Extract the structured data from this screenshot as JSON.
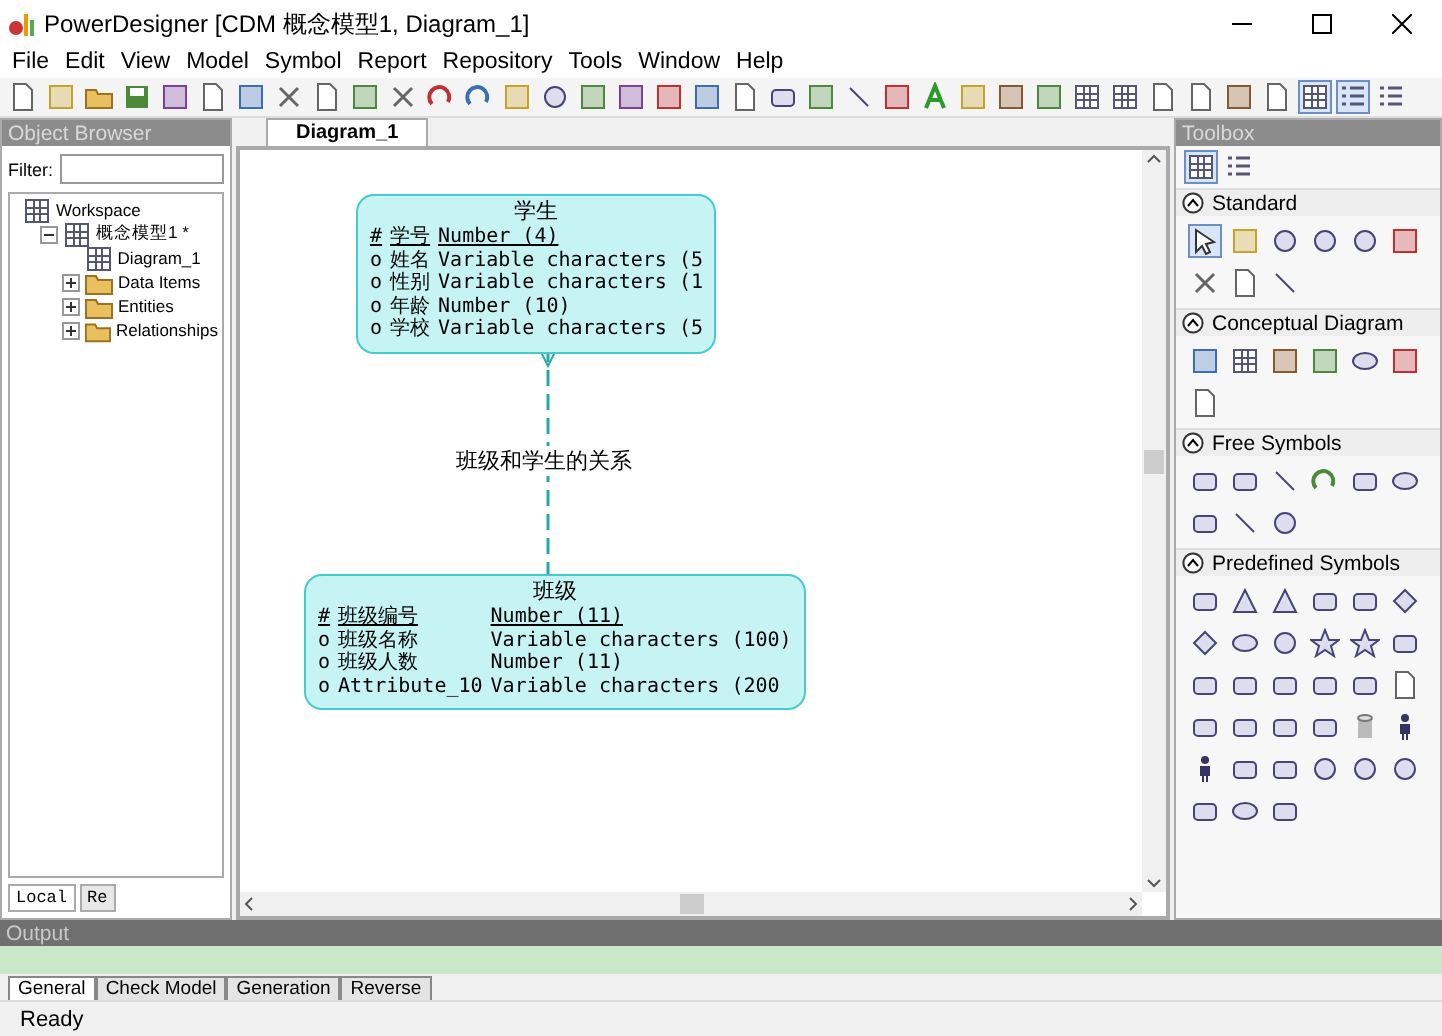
{
  "window": {
    "title": "PowerDesigner [CDM 概念模型1, Diagram_1]"
  },
  "menu": [
    "File",
    "Edit",
    "View",
    "Model",
    "Symbol",
    "Report",
    "Repository",
    "Tools",
    "Window",
    "Help"
  ],
  "object_browser": {
    "title": "Object Browser",
    "filter_label": "Filter:",
    "tree": [
      {
        "label": "Workspace",
        "children": [
          {
            "label": "概念模型1 *",
            "expanded": true,
            "children": [
              {
                "label": "Diagram_1"
              },
              {
                "label": "Data Items",
                "expanded": false
              },
              {
                "label": "Entities",
                "expanded": false
              },
              {
                "label": "Relationships",
                "expanded": false
              }
            ]
          }
        ]
      }
    ],
    "tabs": [
      {
        "label": "Local",
        "selected": true
      },
      {
        "label": "Re",
        "selected": false
      }
    ]
  },
  "document_tabs": [
    {
      "label": "Diagram_1",
      "selected": true
    }
  ],
  "diagram": {
    "entities": [
      {
        "name": "学生",
        "attributes": [
          {
            "marker": "#",
            "name": "学号",
            "type": "Number (4)",
            "identifier": true
          },
          {
            "marker": "o",
            "name": "姓名",
            "type": "Variable characters (5",
            "identifier": false
          },
          {
            "marker": "o",
            "name": "性别",
            "type": "Variable characters (1",
            "identifier": false
          },
          {
            "marker": "o",
            "name": "年龄",
            "type": "Number (10)",
            "identifier": false
          },
          {
            "marker": "o",
            "name": "学校",
            "type": "Variable characters (5",
            "identifier": false
          }
        ]
      },
      {
        "name": "班级",
        "attributes": [
          {
            "marker": "#",
            "name": "班级编号",
            "type": "Number (11)",
            "identifier": true
          },
          {
            "marker": "o",
            "name": "班级名称",
            "type": "Variable characters (100)",
            "identifier": false
          },
          {
            "marker": "o",
            "name": "班级人数",
            "type": "Number (11)",
            "identifier": false
          },
          {
            "marker": "o",
            "name": "Attribute_10",
            "type": "Variable characters (200",
            "identifier": false
          }
        ]
      }
    ],
    "relationship": {
      "label": "班级和学生的关系"
    }
  },
  "toolbox": {
    "title": "Toolbox",
    "views": [
      {
        "selected": true
      },
      {
        "selected": false
      }
    ],
    "sections": [
      {
        "title": "Standard",
        "expanded": true
      },
      {
        "title": "Conceptual Diagram",
        "expanded": true
      },
      {
        "title": "Free Symbols",
        "expanded": true
      },
      {
        "title": "Predefined Symbols",
        "expanded": true
      }
    ]
  },
  "output": {
    "title": "Output",
    "tabs": [
      {
        "label": "General",
        "selected": true
      },
      {
        "label": "Check Model",
        "selected": false
      },
      {
        "label": "Generation",
        "selected": false
      },
      {
        "label": "Reverse",
        "selected": false
      }
    ]
  },
  "status_bar": {
    "text": "Ready"
  }
}
